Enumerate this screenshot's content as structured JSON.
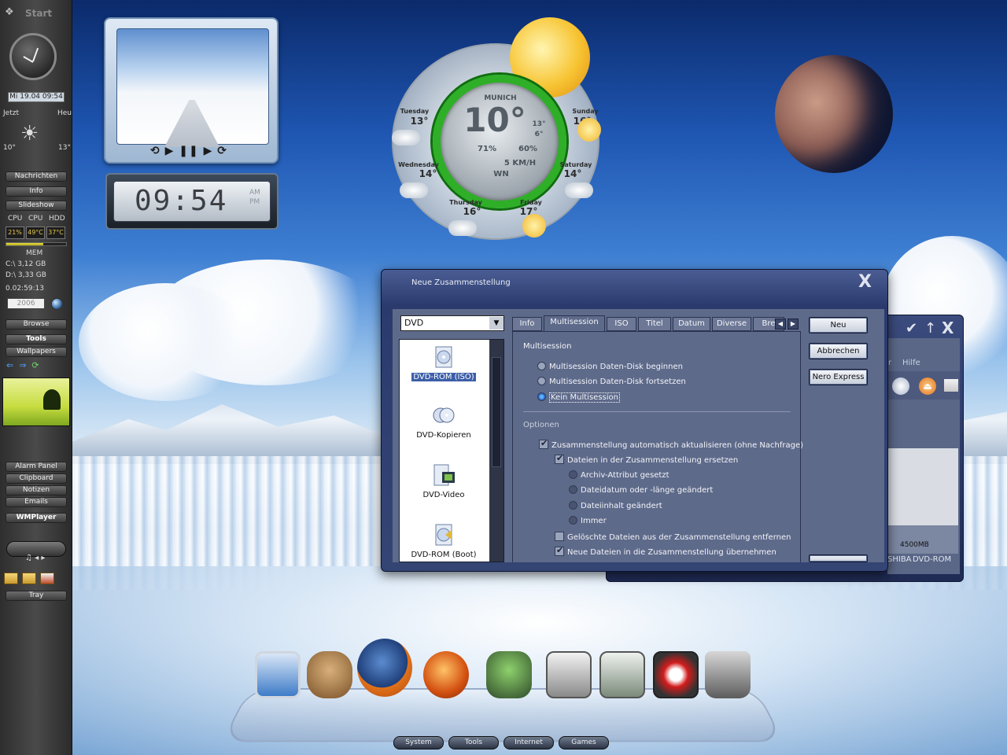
{
  "sidebar": {
    "start_label": "Start",
    "date": "Mi 19.04 09:54",
    "now_label": "Jetzt",
    "today_label": "Heu",
    "temp_now": "10°",
    "temp_today": "13°",
    "buttons": [
      "Nachrichten",
      "Info",
      "Slideshow"
    ],
    "cpu_label1": "CPU",
    "cpu_label2": "CPU",
    "hdd_label": "HDD",
    "cpu_value": "21%",
    "cpu_temp": "49°C",
    "hdd_temp": "37°C",
    "mem_label": "MEM",
    "mem_level": 0.62,
    "drive1": "C:\\ 3,12 GB",
    "drive2": "D:\\ 3,33 GB",
    "uptime": "0.02:59:13",
    "year": "2006",
    "nav_buttons": [
      "Browse",
      "Tools",
      "Wallpapers"
    ],
    "lower_buttons": [
      "Alarm Panel",
      "Clipboard",
      "Notizen",
      "Emails"
    ],
    "wmplayer": "WMPlayer",
    "tray": "Tray"
  },
  "clock_widget": {
    "time": "09:54",
    "am": "AM",
    "pm": "PM"
  },
  "weather": {
    "city": "MUNICH",
    "current_temp": "10°",
    "high": "13°",
    "low": "6°",
    "humidity": "71%",
    "precip": "60%",
    "wind": "5 KM/H",
    "wind_dir": "WN",
    "days": [
      {
        "name": "Tuesday",
        "temp": "13°"
      },
      {
        "name": "Wednesday",
        "temp": "14°"
      },
      {
        "name": "Thursday",
        "temp": "16°"
      },
      {
        "name": "Friday",
        "temp": "17°"
      },
      {
        "name": "Saturday",
        "temp": "14°"
      },
      {
        "name": "Sunday",
        "temp": "16°"
      }
    ]
  },
  "nero_back": {
    "menu_help": "Hilfe",
    "menu_prev": "r",
    "ruler_mark": "4500MB",
    "drive_labels": [
      "SHIBA",
      "DVD-ROM"
    ]
  },
  "dialog": {
    "title": "Neue Zusammenstellung",
    "close_glyph": "X",
    "combo_value": "DVD",
    "disc_types": [
      "DVD-ROM (ISO)",
      "DVD-Kopieren",
      "DVD-Video",
      "DVD-ROM (Boot)"
    ],
    "tabs": [
      "Info",
      "Multisession",
      "ISO",
      "Titel",
      "Datum",
      "Diverse",
      "Bre"
    ],
    "multisession_group": "Multisession",
    "multisession_options": [
      "Multisession Daten-Disk beginnen",
      "Multisession Daten-Disk fortsetzen",
      "Kein Multisession"
    ],
    "options_group": "Optionen",
    "options": {
      "auto_update": "Zusammenstellung automatisch aktualisieren (ohne Nachfrage)",
      "replace_files": "Dateien in der Zusammenstellung ersetzen",
      "archive_attr": "Archiv-Attribut gesetzt",
      "date_length": "Dateidatum oder -länge geändert",
      "content_changed": "Dateiinhalt geändert",
      "always": "Immer",
      "remove_deleted": "Gelöschte Dateien aus der Zusammenstellung entfernen",
      "add_new": "Neue Dateien in die Zusammenstellung übernehmen"
    },
    "buttons": [
      "Neu",
      "Abbrechen",
      "Nero Express"
    ]
  },
  "dock": {
    "tabs": [
      "System",
      "Tools",
      "Internet",
      "Games"
    ]
  },
  "colors": {
    "dialog_bg": "#5e6a8a",
    "dialog_title": "#2b3a6d",
    "accent_green": "#2fae28",
    "sidebar_bg": "#3a3a3a"
  }
}
